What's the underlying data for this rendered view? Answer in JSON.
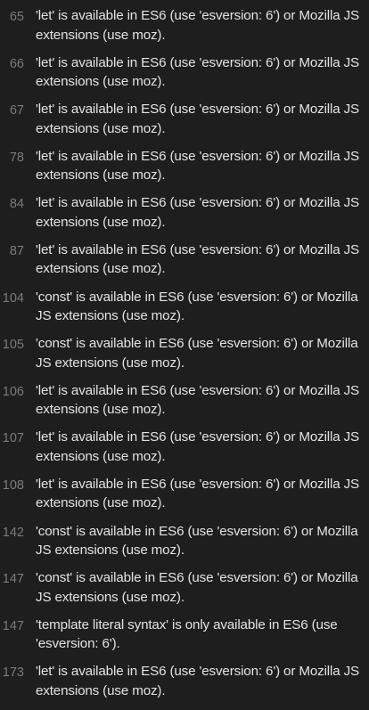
{
  "issues": [
    {
      "line": "65",
      "message": "'let' is available in ES6 (use 'esversion: 6') or Mozilla JS extensions (use moz)."
    },
    {
      "line": "66",
      "message": "'let' is available in ES6 (use 'esversion: 6') or Mozilla JS extensions (use moz)."
    },
    {
      "line": "67",
      "message": "'let' is available in ES6 (use 'esversion: 6') or Mozilla JS extensions (use moz)."
    },
    {
      "line": "78",
      "message": "'let' is available in ES6 (use 'esversion: 6') or Mozilla JS extensions (use moz)."
    },
    {
      "line": "84",
      "message": "'let' is available in ES6 (use 'esversion: 6') or Mozilla JS extensions (use moz)."
    },
    {
      "line": "87",
      "message": "'let' is available in ES6 (use 'esversion: 6') or Mozilla JS extensions (use moz)."
    },
    {
      "line": "104",
      "message": "'const' is available in ES6 (use 'esversion: 6') or Mozilla JS extensions (use moz)."
    },
    {
      "line": "105",
      "message": "'const' is available in ES6 (use 'esversion: 6') or Mozilla JS extensions (use moz)."
    },
    {
      "line": "106",
      "message": "'let' is available in ES6 (use 'esversion: 6') or Mozilla JS extensions (use moz)."
    },
    {
      "line": "107",
      "message": "'let' is available in ES6 (use 'esversion: 6') or Mozilla JS extensions (use moz)."
    },
    {
      "line": "108",
      "message": "'let' is available in ES6 (use 'esversion: 6') or Mozilla JS extensions (use moz)."
    },
    {
      "line": "142",
      "message": "'const' is available in ES6 (use 'esversion: 6') or Mozilla JS extensions (use moz)."
    },
    {
      "line": "147",
      "message": "'const' is available in ES6 (use 'esversion: 6') or Mozilla JS extensions (use moz)."
    },
    {
      "line": "147",
      "message": "'template literal syntax' is only available in ES6 (use 'esversion: 6')."
    },
    {
      "line": "173",
      "message": "'let' is available in ES6 (use 'esversion: 6') or Mozilla JS extensions (use moz)."
    }
  ]
}
